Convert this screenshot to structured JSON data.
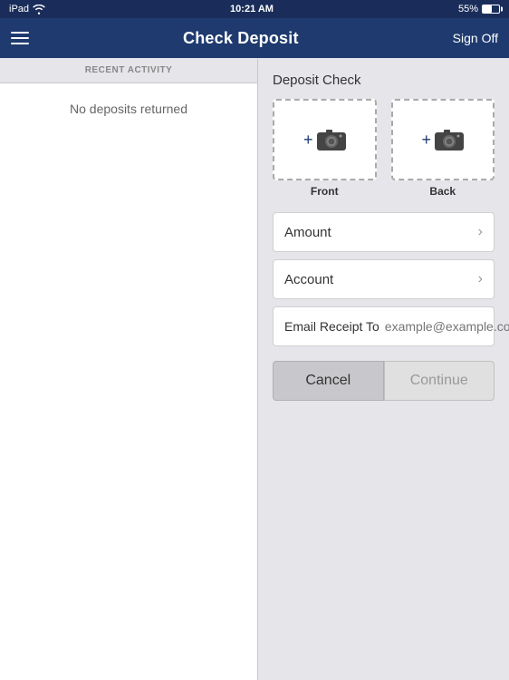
{
  "status_bar": {
    "left": "iPad",
    "time": "10:21 AM",
    "battery": "55%",
    "wifi": true
  },
  "nav": {
    "title": "Check Deposit",
    "sign_off_label": "Sign Off",
    "menu_icon": "hamburger-menu"
  },
  "left_panel": {
    "header": "RECENT ACTIVITY",
    "empty_message": "No deposits returned"
  },
  "right_panel": {
    "section_title": "Deposit Check",
    "front_photo": {
      "plus": "+",
      "label": "Front"
    },
    "back_photo": {
      "plus": "+",
      "label": "Back"
    },
    "amount_label": "Amount",
    "account_label": "Account",
    "email_label": "Email Receipt To",
    "email_placeholder": "example@example.com",
    "cancel_label": "Cancel",
    "continue_label": "Continue"
  }
}
